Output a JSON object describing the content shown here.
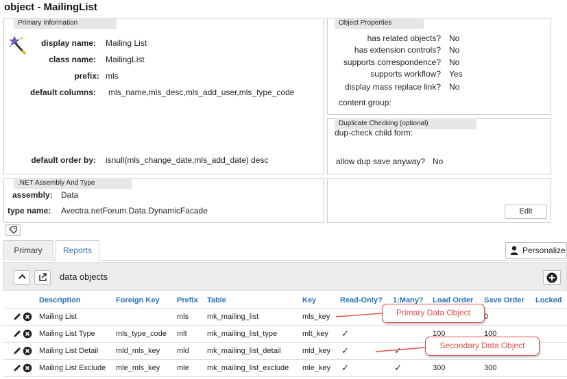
{
  "page": {
    "title": "object - MailingList"
  },
  "primary_info": {
    "legend": "Primary Information",
    "icon": "wizard-wand-icon",
    "display_name_label": "display name:",
    "display_name": "Mailing List",
    "class_name_label": "class name:",
    "class_name": "MailingList",
    "prefix_label": "prefix:",
    "prefix": "mls",
    "default_columns_label": "default columns:",
    "default_columns": "mls_name,mls_desc,mls_add_user,mls_type_code",
    "default_order_label": "default order by:",
    "default_order": "isnull(mls_change_date,mls_add_date) desc"
  },
  "object_properties": {
    "legend": "Object Properties",
    "items": [
      {
        "label": "has related objects?",
        "value": "No"
      },
      {
        "label": "has extension controls?",
        "value": "No"
      },
      {
        "label": "supports correspondence?",
        "value": "No"
      },
      {
        "label": "supports workflow?",
        "value": "Yes"
      },
      {
        "label": "display mass replace link?",
        "value": "No"
      }
    ],
    "content_group_label": "content group:",
    "content_group": ""
  },
  "duplicate_checking": {
    "legend": "Duplicate Checking (optional)",
    "child_form_label": "dup-check child form:",
    "child_form": "",
    "allow_dup_label": "allow dup save anyway?",
    "allow_dup": "No"
  },
  "net_assembly": {
    "legend": ".NET Assembly And Type",
    "assembly_label": "assembly:",
    "assembly": "Data",
    "type_name_label": "type name:",
    "type_name": "Avectra.netForum.Data.DynamicFacade"
  },
  "edit_button": "Edit",
  "tabs": [
    {
      "label": "Primary"
    },
    {
      "label": "Reports"
    }
  ],
  "personalize_button": "Personalize",
  "toolbar": {
    "title": "data objects"
  },
  "grid": {
    "columns": [
      "Description",
      "Foreign Key",
      "Prefix",
      "Table",
      "Key",
      "Read-Only?",
      "1:Many?",
      "Load Order",
      "Save Order",
      "Locked"
    ],
    "rows": [
      {
        "description": "Mailing List",
        "foreign_key": "",
        "prefix": "mls",
        "table": "mk_mailing_list",
        "key": "mls_key",
        "read_only": "",
        "one_many": "",
        "load_order": "",
        "save_order": "0",
        "locked": ""
      },
      {
        "description": "Mailing List Type",
        "foreign_key": "mls_type_code",
        "prefix": "mlt",
        "table": "mk_mailing_list_type",
        "key": "mlt_key",
        "read_only": "✓",
        "one_many": "",
        "load_order": "100",
        "save_order": "100",
        "locked": ""
      },
      {
        "description": "Mailing List Detail",
        "foreign_key": "mld_mls_key",
        "prefix": "mld",
        "table": "mk_mailing_list_detail",
        "key": "mld_key",
        "read_only": "✓",
        "one_many": "✓",
        "load_order": "",
        "save_order": "",
        "locked": ""
      },
      {
        "description": "Mailing List Exclude",
        "foreign_key": "mle_mls_key",
        "prefix": "mle",
        "table": "mk_mailing_list_exclude",
        "key": "mle_key",
        "read_only": "✓",
        "one_many": "✓",
        "load_order": "300",
        "save_order": "300",
        "locked": ""
      }
    ]
  },
  "callouts": {
    "primary": "Primary Data Object",
    "secondary": "Secondary Data Object"
  },
  "colors": {
    "link_blue": "#2a73b8",
    "callout_red": "#e0504a",
    "legend_gray": "#e6e6e6"
  }
}
